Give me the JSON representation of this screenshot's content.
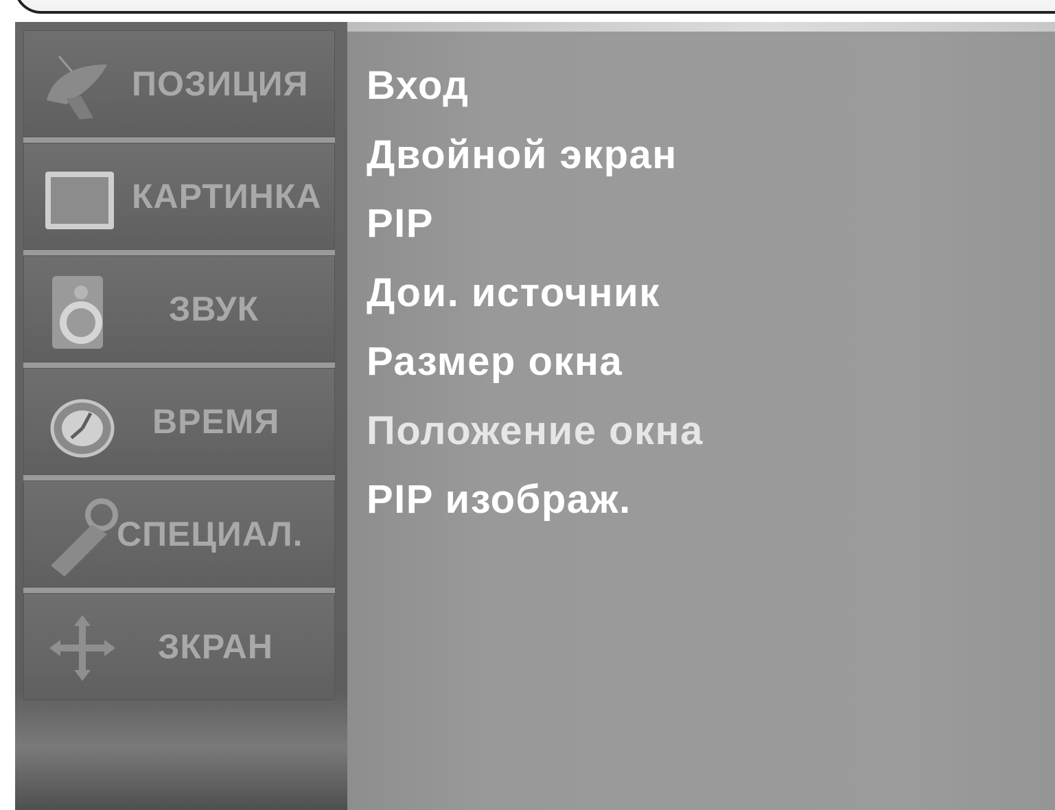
{
  "sidebar": {
    "items": [
      {
        "label": "ПОЗИЦИЯ",
        "icon": "satellite-dish-icon"
      },
      {
        "label": "КАРТИНКА",
        "icon": "picture-frame-icon"
      },
      {
        "label": "ЗВУК",
        "icon": "speaker-icon"
      },
      {
        "label": "ВРЕМЯ",
        "icon": "clock-icon"
      },
      {
        "label": "СПЕЦИАЛ.",
        "icon": "key-tag-icon"
      },
      {
        "label": "ЗКРАН",
        "icon": "move-arrows-icon"
      }
    ]
  },
  "main": {
    "items": [
      {
        "label": "Вход"
      },
      {
        "label": "Двойной экран"
      },
      {
        "label": "PIP"
      },
      {
        "label": "Дои. источник"
      },
      {
        "label": "Размер окна"
      },
      {
        "label": "Положение окна"
      },
      {
        "label": "PIP изображ."
      }
    ]
  },
  "colors": {
    "sidebar_bg": "#666666",
    "sidebar_text": "#a9a9a9",
    "main_bg": "#999999",
    "main_text": "#ffffff"
  }
}
